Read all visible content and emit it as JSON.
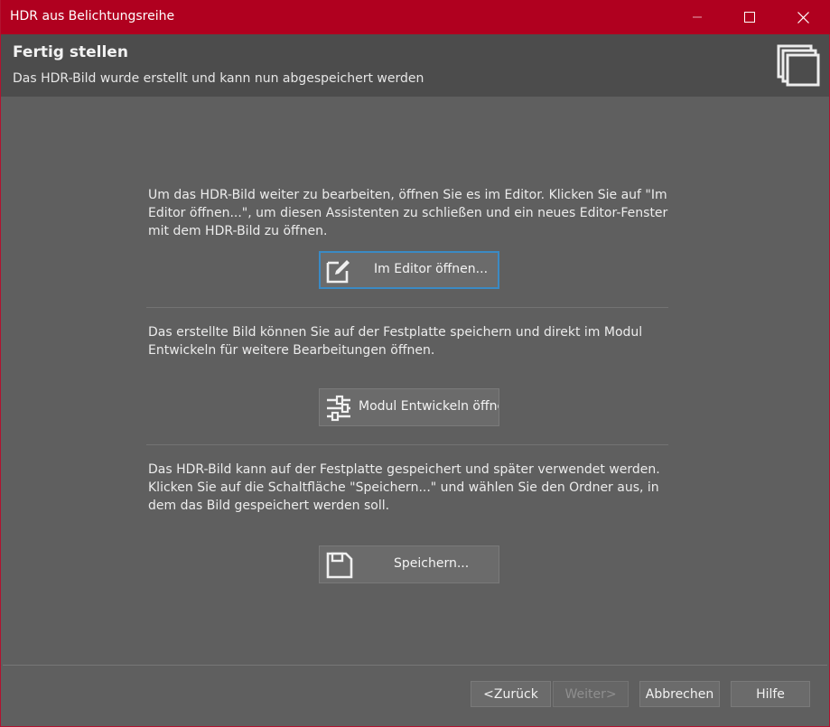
{
  "window": {
    "title": "HDR aus Belichtungsreihe",
    "controls": {
      "minimize": "minimize-icon",
      "maximize": "maximize-icon",
      "close": "close-icon"
    }
  },
  "header": {
    "title": "Fertig stellen",
    "subtitle": "Das HDR-Bild wurde erstellt und kann nun abgespeichert werden",
    "icon": "stacked-pages-icon"
  },
  "sections": {
    "editor": {
      "text": "Um das HDR-Bild weiter zu bearbeiten, öffnen Sie es im Editor. Klicken Sie auf \"Im Editor öffnen...\", um diesen Assistenten zu schließen und ein neues Editor-Fenster mit dem HDR-Bild zu öffnen.",
      "button_label": "Im Editor öffnen...",
      "icon": "edit-icon"
    },
    "develop": {
      "text": "Das erstellte Bild können Sie auf der Festplatte speichern und direkt im Modul Entwickeln für weitere Bearbeitungen öffnen.",
      "button_label": "Modul Entwickeln öffnen",
      "icon": "sliders-icon"
    },
    "save": {
      "text": "Das HDR-Bild kann auf der Festplatte gespeichert und später verwendet werden. Klicken Sie auf die Schaltfläche \"Speichern...\" und wählen Sie den Ordner aus, in dem das Bild gespeichert werden soll.",
      "button_label": "Speichern...",
      "icon": "floppy-disk-icon"
    }
  },
  "footer": {
    "back": "<Zurück",
    "next": "Weiter>",
    "cancel": "Abbrechen",
    "help": "Hilfe"
  },
  "colors": {
    "titlebar": "#b0001f",
    "background": "#5f5f5f",
    "header": "#4c4c4c",
    "focus": "#3b8ac4"
  }
}
